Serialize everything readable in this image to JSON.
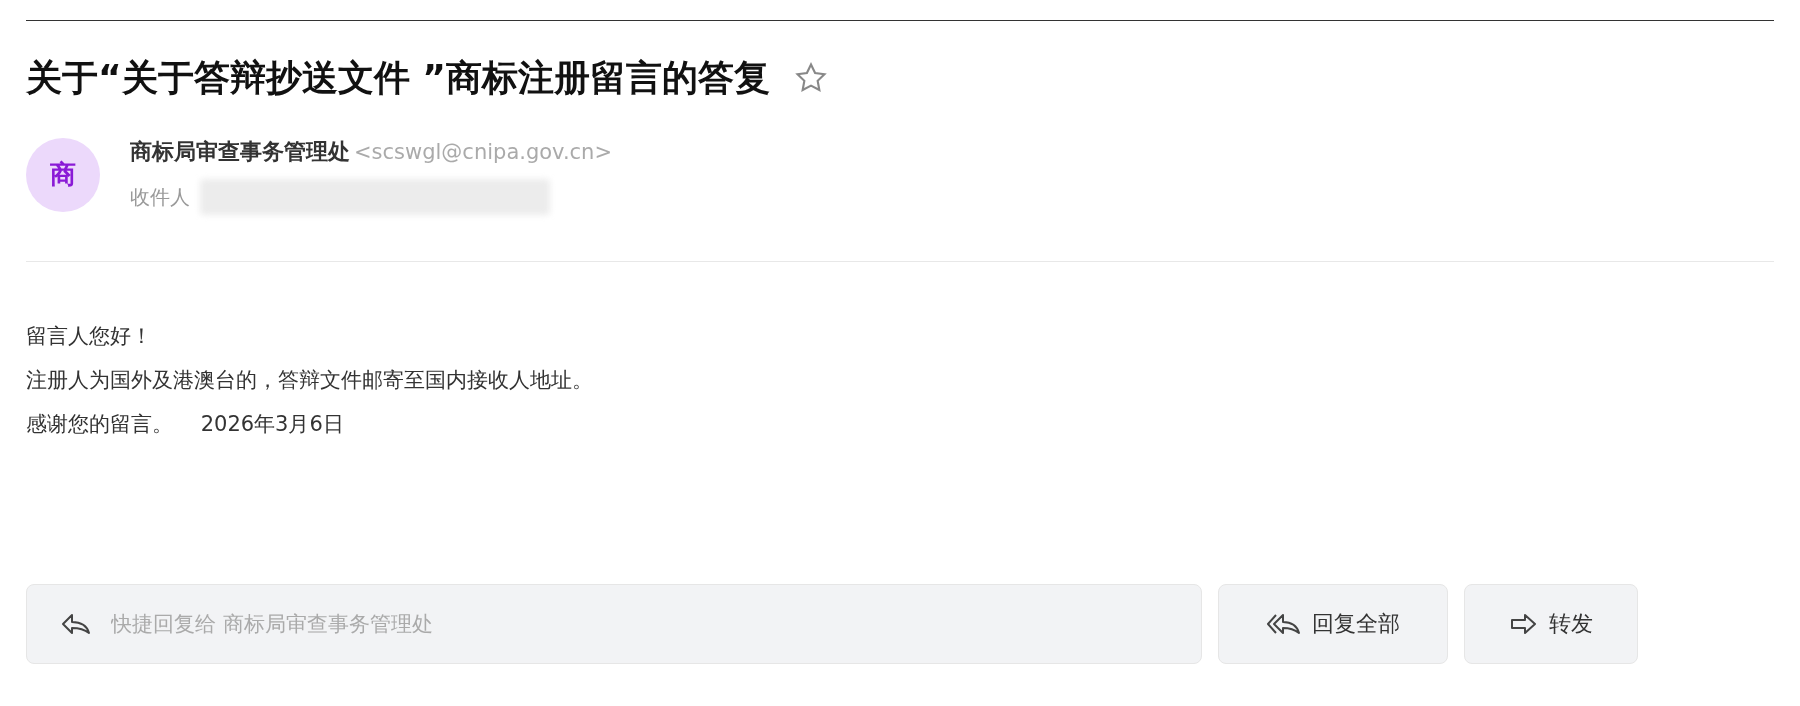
{
  "email": {
    "subject": "关于“关于答辩抄送文件 ”商标注册留言的答复",
    "starred": false,
    "sender": {
      "avatar": "商",
      "name": "商标局审查事务管理处",
      "address": "<scswgl@cnipa.gov.cn>"
    },
    "recipient_label": "收件人",
    "body": [
      "留言人您好！",
      "注册人为国外及港澳台的，答辩文件邮寄至国内接收人地址。",
      "感谢您的留言。　 2026年3月6日"
    ]
  },
  "actions": {
    "quick_reply": {
      "placeholder": "快捷回复给 商标局审查事务管理处"
    },
    "reply_all": "回复全部",
    "forward": "转发"
  }
}
